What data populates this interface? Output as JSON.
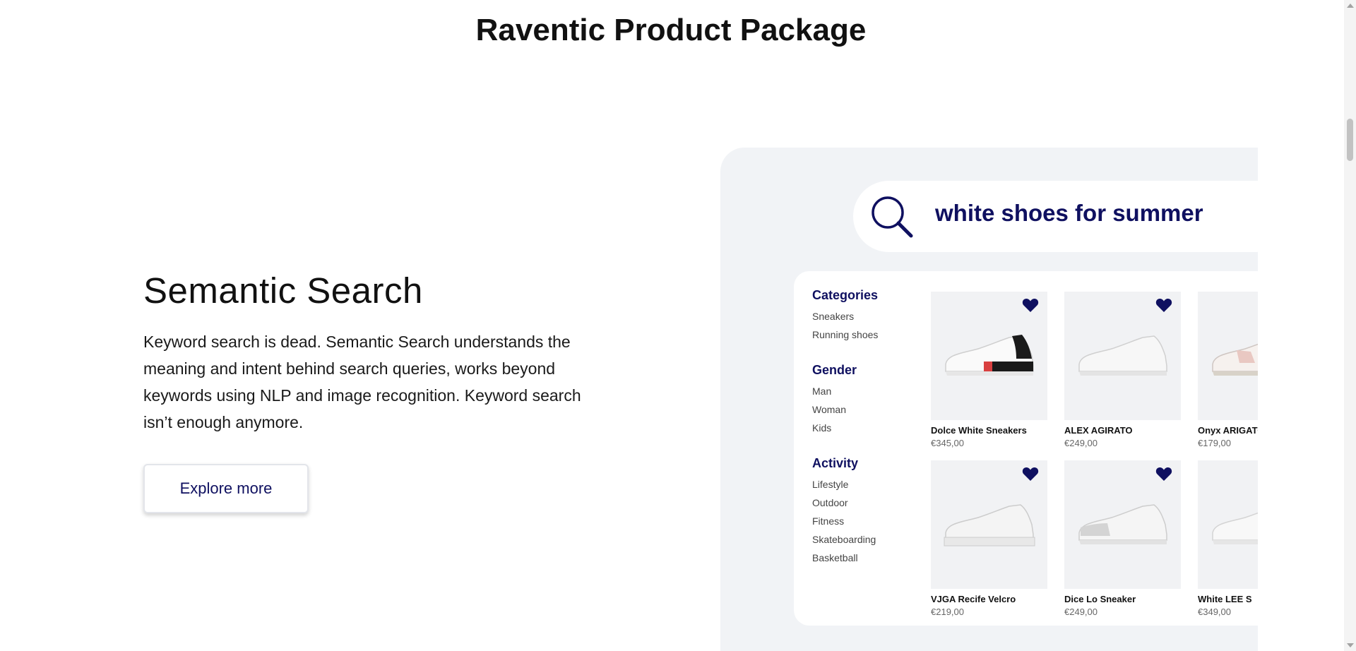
{
  "page": {
    "title": "Raventic Product Package"
  },
  "feature": {
    "title": "Semantic Search",
    "description": "Keyword search is dead. Semantic Search understands the meaning and intent behind search queries, works beyond keywords using NLP and image recognition. Keyword search isn’t enough anymore.",
    "button_label": "Explore more"
  },
  "search": {
    "query": "white shoes for summer",
    "icon": "search-icon"
  },
  "filters": [
    {
      "heading": "Categories",
      "options": [
        "Sneakers",
        "Running shoes"
      ]
    },
    {
      "heading": "Gender",
      "options": [
        "Man",
        "Woman",
        "Kids"
      ]
    },
    {
      "heading": "Activity",
      "options": [
        "Lifestyle",
        "Outdoor",
        "Fitness",
        "Skateboarding",
        "Basketball"
      ]
    }
  ],
  "products": [
    {
      "name": "Dolce White Sneakers",
      "price": "€345,00",
      "favorited": true
    },
    {
      "name": "ALEX AGIRATO",
      "price": "€249,00",
      "favorited": true
    },
    {
      "name": "Onyx ARIGATO",
      "price": "€179,00",
      "favorited": false
    },
    {
      "name": "VJGA Recife Velcro",
      "price": "€219,00",
      "favorited": true
    },
    {
      "name": "Dice Lo Sneaker",
      "price": "€249,00",
      "favorited": true
    },
    {
      "name": "White LEE S",
      "price": "€349,00",
      "favorited": false
    }
  ],
  "colors": {
    "brand_navy": "#0f1060",
    "panel_bg": "#f1f3f6",
    "card_bg": "#f1f2f4"
  }
}
